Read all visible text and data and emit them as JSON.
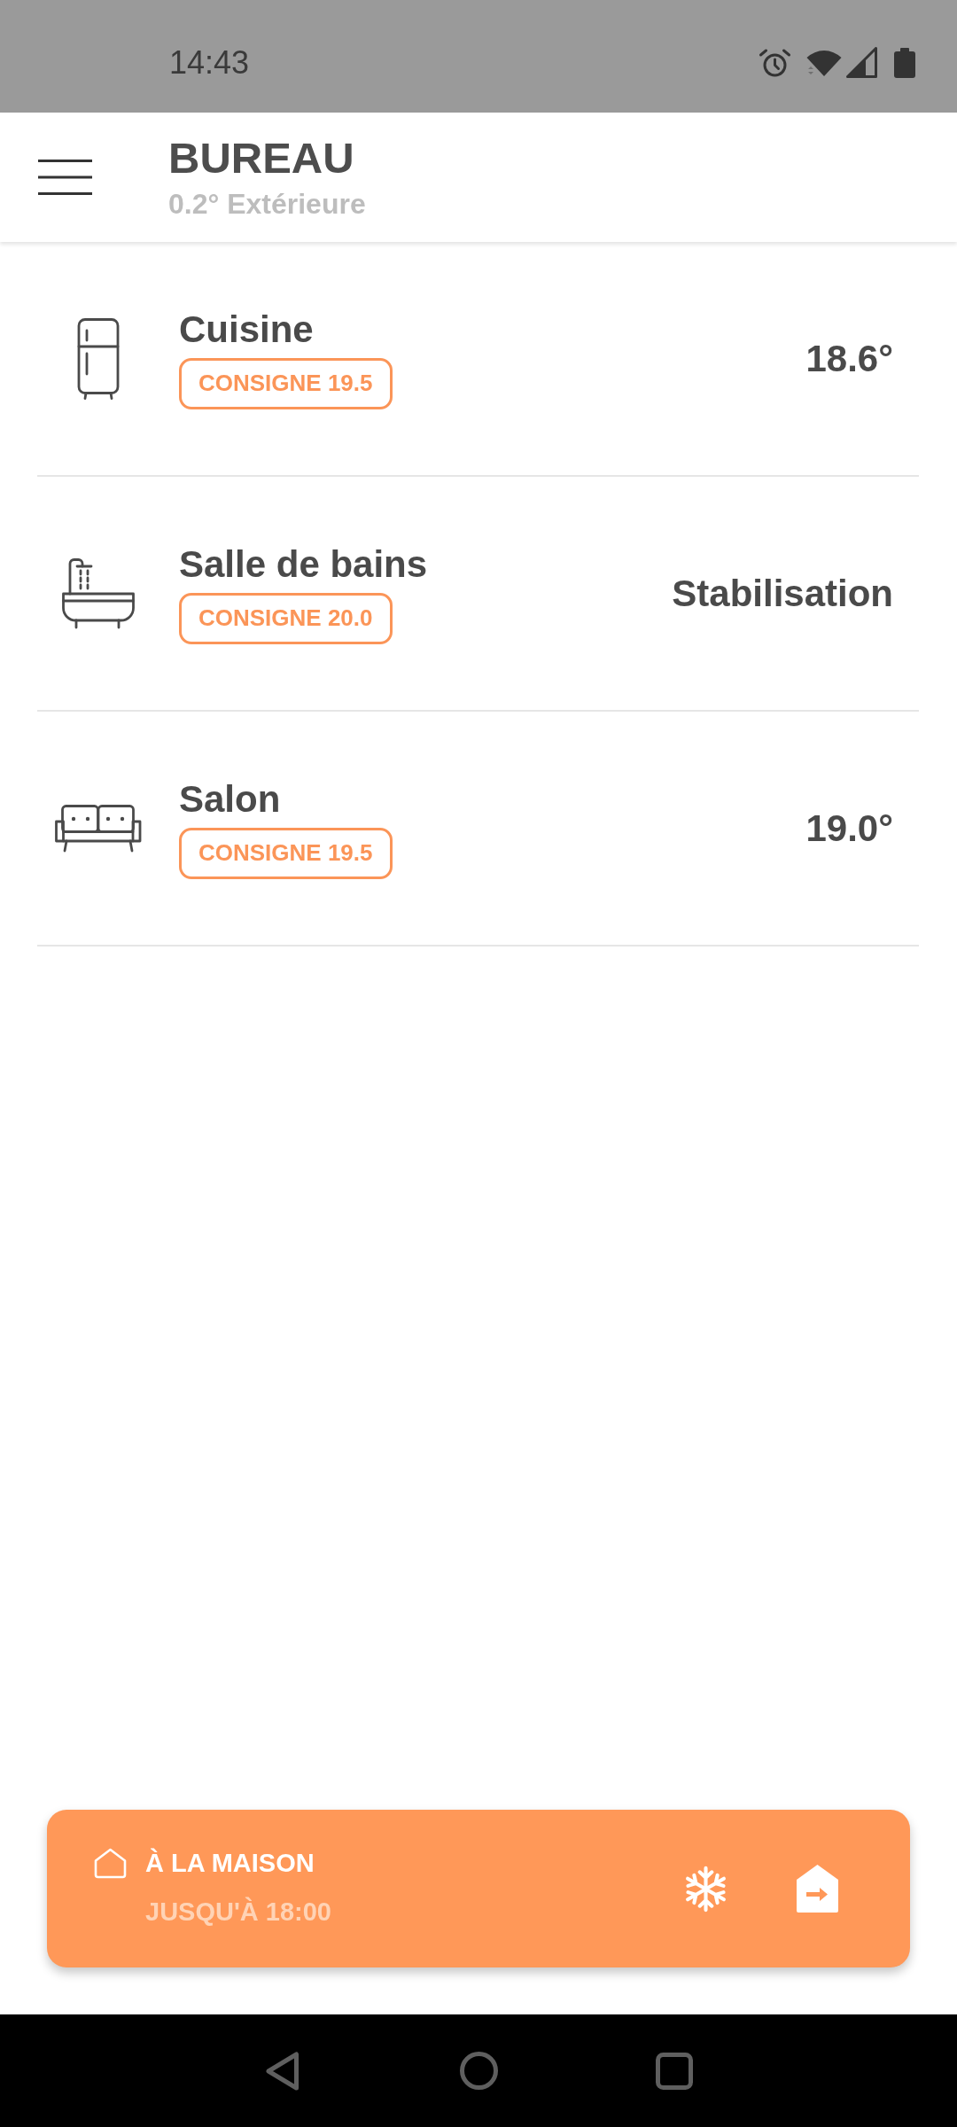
{
  "status_bar": {
    "time": "14:43"
  },
  "header": {
    "title": "BUREAU",
    "subtitle": "0.2° Extérieure"
  },
  "rooms": [
    {
      "kind": "fridge",
      "name": "Cuisine",
      "setpoint": "CONSIGNE 19.5",
      "reading": "18.6°"
    },
    {
      "kind": "bathtub",
      "name": "Salle de bains",
      "setpoint": "CONSIGNE 20.0",
      "reading": "Stabilisation"
    },
    {
      "kind": "sofa",
      "name": "Salon",
      "setpoint": "CONSIGNE 19.5",
      "reading": "19.0°"
    }
  ],
  "mode_bar": {
    "title": "À LA MAISON",
    "until": "JUSQU'À 18:00"
  }
}
